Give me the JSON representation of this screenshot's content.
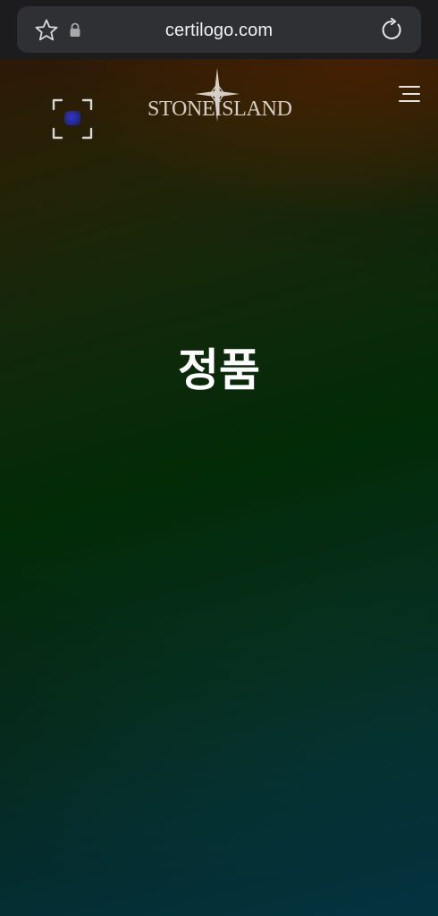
{
  "browser": {
    "url": "certilogo.com",
    "icons": {
      "favorite": "star-icon",
      "secure": "lock-icon",
      "reload": "reload-icon"
    }
  },
  "header": {
    "brand_left": "STONE",
    "brand_right": "ISLAND",
    "icons": {
      "scan": "scan-frame-icon",
      "menu": "hamburger-menu-icon",
      "brand_mark": "compass-star-icon"
    }
  },
  "result": {
    "heading": "정품"
  },
  "colors": {
    "browser_bar": "#1c1c1e",
    "address_pill": "#2f3033",
    "brand_text": "#d6cfc6",
    "heading_text": "#ffffff",
    "gradient_top": "#3a1f07",
    "gradient_mid": "#022b06",
    "gradient_bottom": "#054456"
  }
}
